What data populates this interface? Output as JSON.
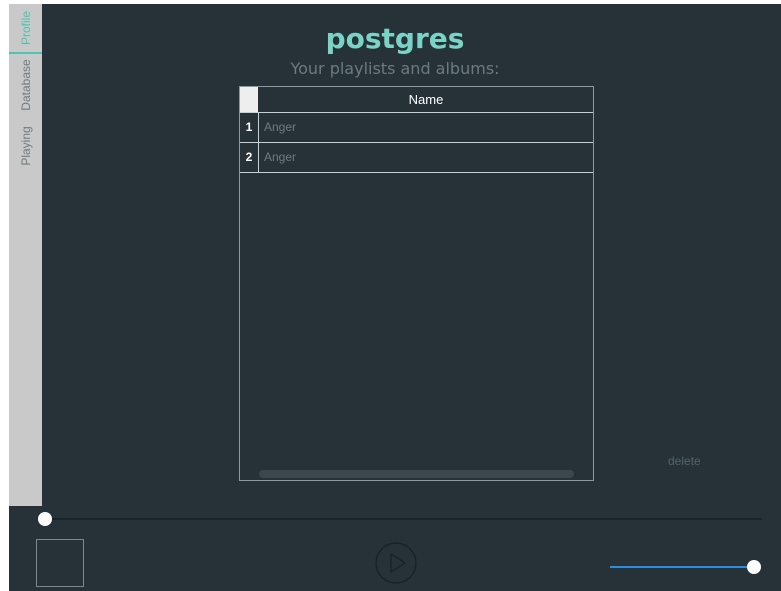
{
  "tabs": [
    {
      "label": "Profile",
      "active": true
    },
    {
      "label": "Database",
      "active": false
    },
    {
      "label": "Playing",
      "active": false
    }
  ],
  "header": {
    "title": "postgres",
    "subtitle": "Your playlists and albums:"
  },
  "table": {
    "columns": [
      "Name"
    ],
    "rows": [
      {
        "index": "1",
        "name": "Anger"
      },
      {
        "index": "2",
        "name": "Anger"
      }
    ]
  },
  "actions": {
    "delete_label": "delete"
  },
  "player": {
    "seek_position": 0,
    "volume_level": 1.0
  },
  "colors": {
    "accent": "#7ad3c6",
    "background": "#263238",
    "volume": "#2b8ce0"
  }
}
